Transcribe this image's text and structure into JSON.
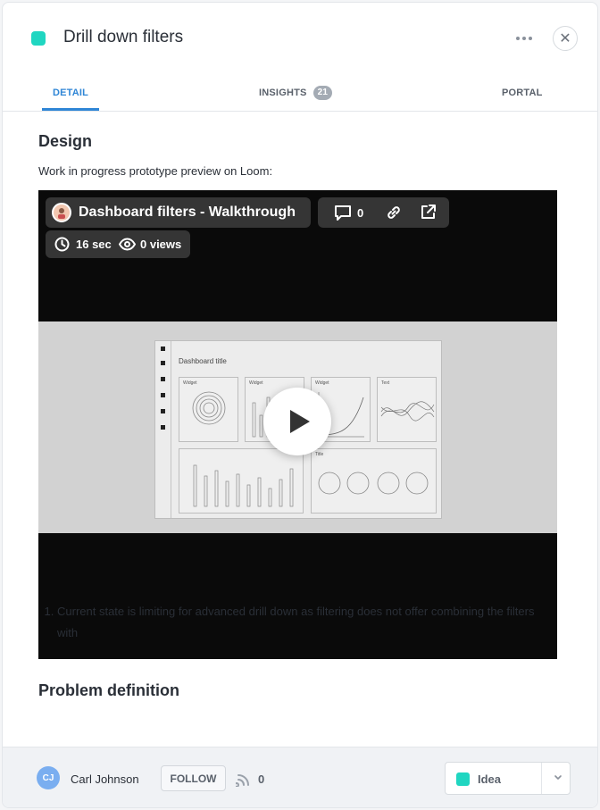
{
  "header": {
    "title": "Drill down filters",
    "status_color": "#20d6c1",
    "more_icon": "ellipsis-icon",
    "close_icon": "close-icon",
    "close_glyph": "✕"
  },
  "tabs": [
    {
      "label": "DETAIL",
      "active": true
    },
    {
      "label": "INSIGHTS",
      "badge": "21"
    },
    {
      "label": "PORTAL"
    }
  ],
  "content": {
    "design_heading": "Design",
    "design_text": "Work in progress prototype preview on Loom:",
    "video": {
      "title": "Dashboard filters - Walkthrough",
      "comment_count": "0",
      "duration": "16 sec",
      "views": "0 views",
      "preview": {
        "dashboard_title": "Dashboard title",
        "widget_labels": [
          "Widget",
          "Widget",
          "Widget",
          "Text"
        ],
        "bottom_right_label": "Title"
      }
    },
    "problem_heading": "Problem definition",
    "problem_items": [
      "Current state is limiting for advanced drill down as filtering does not offer combining the filters with"
    ]
  },
  "footer": {
    "user_initials": "CJ",
    "user_name": "Carl Johnson",
    "follow_label": "FOLLOW",
    "signal_count": "0",
    "status_label": "Idea",
    "status_color": "#20d6c1",
    "accent": "#2f86d6"
  }
}
